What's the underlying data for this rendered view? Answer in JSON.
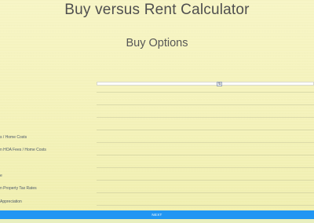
{
  "header": {
    "title": "Buy versus Rent Calculator"
  },
  "section": {
    "title": "Buy Options"
  },
  "input": {
    "value": "",
    "stepper_label": "⇅"
  },
  "labels": [
    "s / Home Costs",
    "n HOA Fees / Home Costs",
    "e",
    "n Property Tax Rates",
    "Appreciation"
  ],
  "actions": {
    "next_label": "NEXT"
  },
  "colors": {
    "background": "#f6f4bd",
    "accent": "#2196f3"
  }
}
